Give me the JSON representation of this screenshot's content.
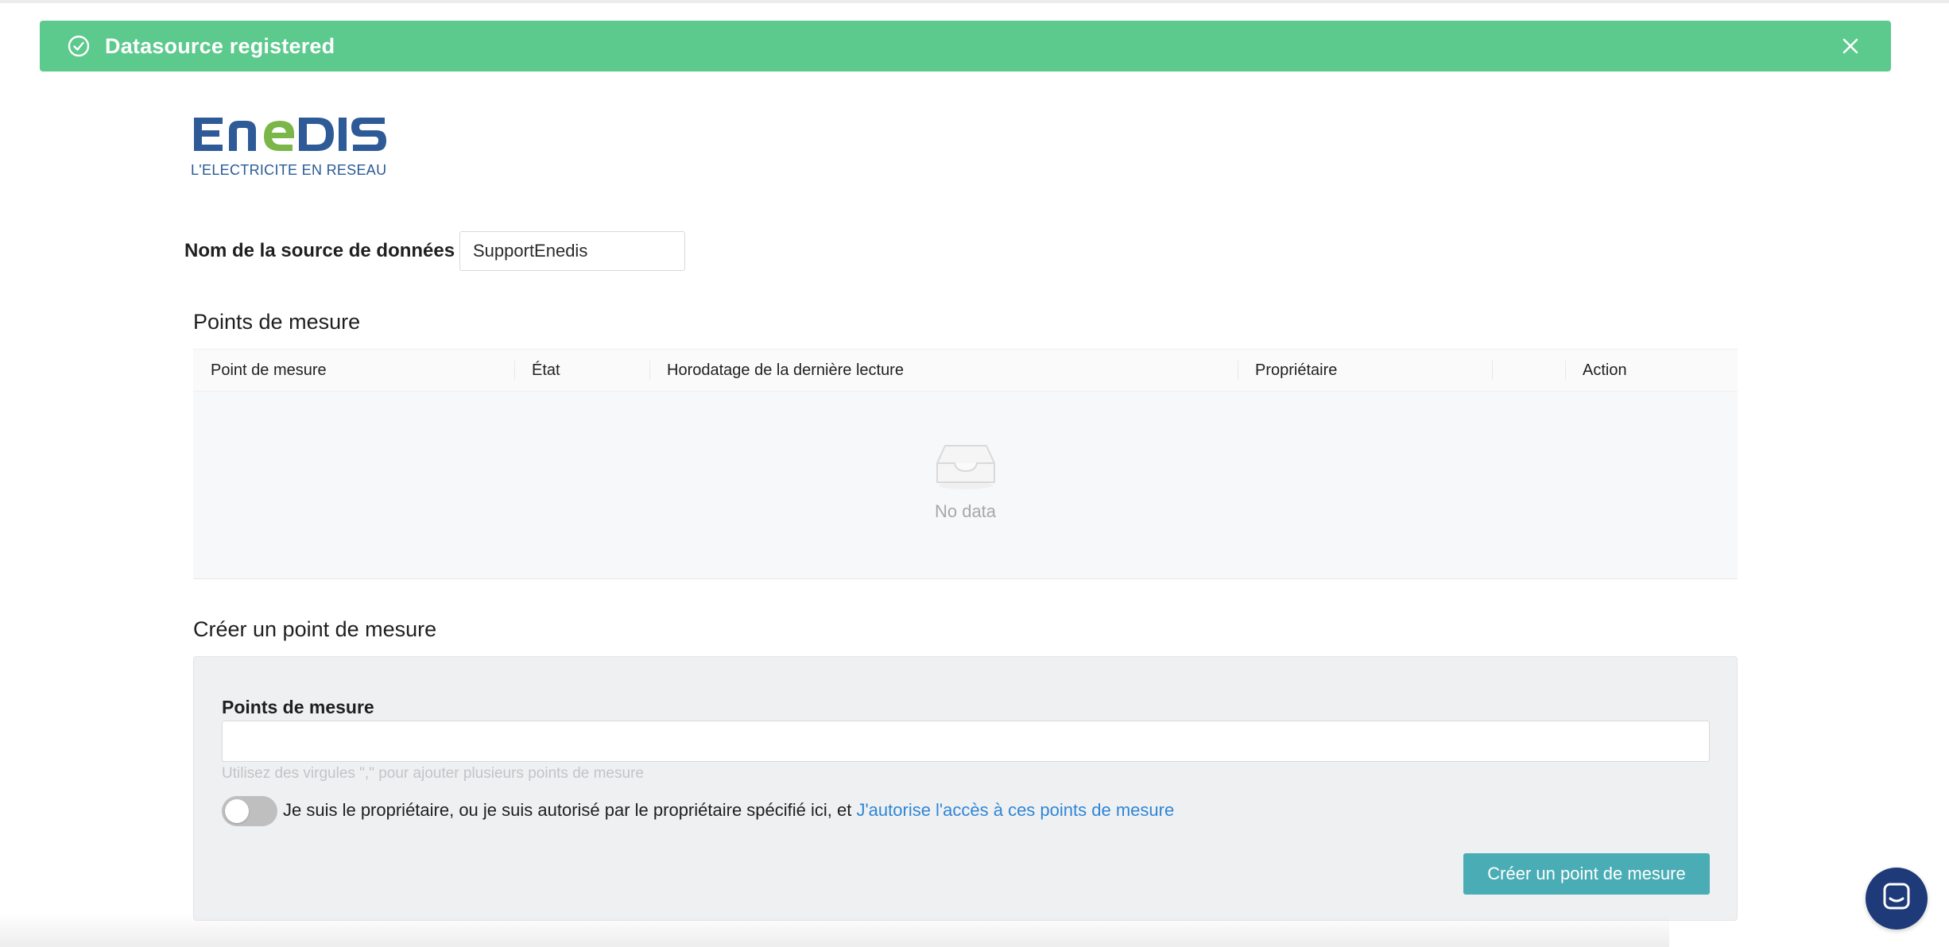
{
  "toast": {
    "message": "Datasource registered",
    "icon": "check-circle-icon",
    "close_icon": "close-icon",
    "color": "#5cc98d"
  },
  "logo": {
    "wordmark": "ENEDIS",
    "tagline": "L'ELECTRICITE EN RESEAU"
  },
  "datasource": {
    "label": "Nom de la source de données",
    "value": "SupportEnedis"
  },
  "measure_points": {
    "title": "Points de mesure",
    "columns": [
      "Point de mesure",
      "État",
      "Horodatage de la dernière lecture",
      "Propriétaire",
      "",
      "Action"
    ],
    "empty_text": "No data",
    "empty_icon": "inbox-icon"
  },
  "create": {
    "title": "Créer un point de mesure",
    "field_label": "Points de mesure",
    "field_value": "",
    "help": "Utilisez des virgules \",\" pour ajouter plusieurs points de mesure",
    "toggle_on": false,
    "consent_text": "Je suis le propriétaire, ou je suis autorisé par le propriétaire spécifié ici, et",
    "consent_link": "J'autorise l'accès à ces points de mesure",
    "button": "Créer un point de mesure",
    "button_color": "#4aadb5"
  },
  "chat": {
    "icon": "chat-icon",
    "color": "#1f3a78"
  }
}
